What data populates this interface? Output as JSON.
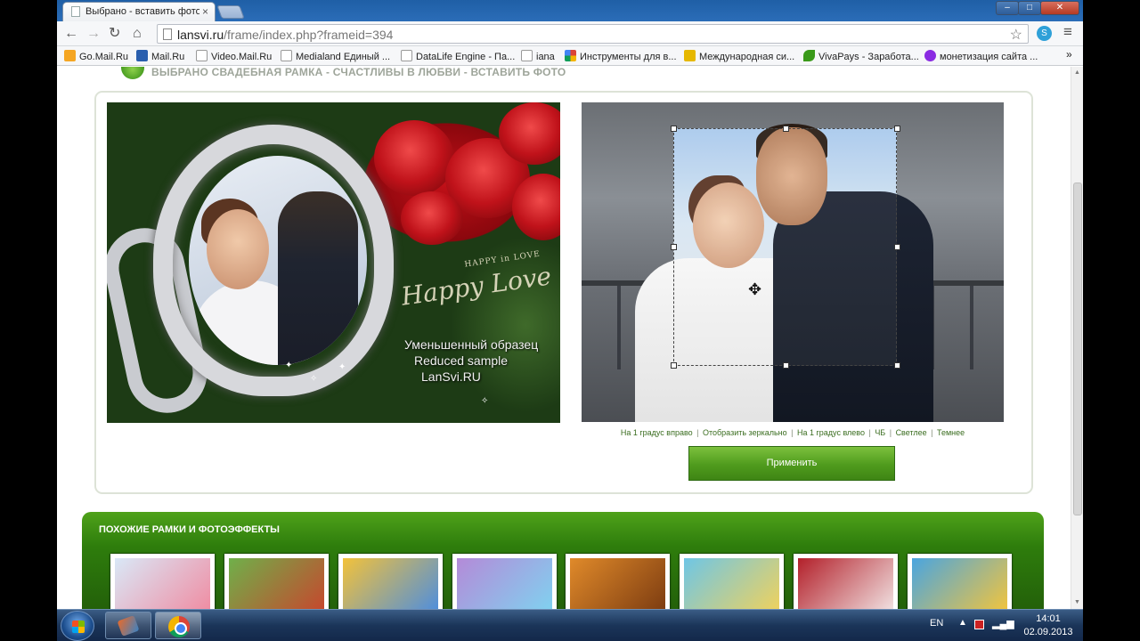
{
  "tab": {
    "title": "Выбрано - вставить фото",
    "close": "×"
  },
  "window": {
    "min": "–",
    "max": "□",
    "close": "✕"
  },
  "toolbar": {
    "back": "←",
    "forward": "→",
    "reload": "↻",
    "home": "⌂",
    "url_host": "lansvi.ru",
    "url_path": "/frame/index.php?frameid=394",
    "star": "☆",
    "menu": "≡"
  },
  "bookmarks": [
    {
      "label": "Go.Mail.Ru",
      "icon": "mail-icon",
      "color": "#f5a623"
    },
    {
      "label": "Mail.Ru",
      "icon": "mail-icon",
      "color": "#2a5fae"
    },
    {
      "label": "Video.Mail.Ru",
      "icon": "page-icon",
      "color": "#ffffff"
    },
    {
      "label": "Medialand Единый ...",
      "icon": "page-icon",
      "color": "#ffffff"
    },
    {
      "label": "DataLife Engine - Па...",
      "icon": "page-icon",
      "color": "#ffffff"
    },
    {
      "label": "iana",
      "icon": "page-icon",
      "color": "#ffffff"
    },
    {
      "label": "Инструменты для в...",
      "icon": "google-icon",
      "color": "#4285f4"
    },
    {
      "label": "Международная си...",
      "icon": "gl-icon",
      "color": "#e6b800"
    },
    {
      "label": "VivaPays - Заработа...",
      "icon": "leaf-icon",
      "color": "#3a9a1a"
    },
    {
      "label": "монетизация сайта ...",
      "icon": "star-icon",
      "color": "#8a2be2"
    }
  ],
  "bookmarks_more": "»",
  "section_title": "ВЫБРАНО СВАДЕБНАЯ РАМКА - СЧАСТЛИВЫ В ЛЮБВИ - ВСТАВИТЬ ФОТО",
  "preview": {
    "watermark": [
      "Уменьшенный образец",
      "Reduced sample",
      "LanSvi.RU"
    ],
    "happy_small": "HAPPY in LOVE",
    "happy_script": "Happy Love"
  },
  "edit_links": [
    "На 1 градус вправо",
    "Отобразить зеркально",
    "На 1 градус влево",
    "ЧБ",
    "Светлее",
    "Темнее"
  ],
  "apply_button": "Применить",
  "similar": {
    "title": "ПОХОЖИЕ РАМКИ И ФОТОЭФФЕКТЫ",
    "thumbs": [
      {
        "color": "#d9e8f7",
        "accent": "#f08aa0"
      },
      {
        "color": "#6fb04a",
        "accent": "#c8452d"
      },
      {
        "color": "#f3c23a",
        "accent": "#4b8de0"
      },
      {
        "color": "#b48ad8",
        "accent": "#7fd3f0"
      },
      {
        "color": "#e08a2a",
        "accent": "#7a3a10"
      },
      {
        "color": "#6ec6e6",
        "accent": "#f2d25a"
      },
      {
        "color": "#b3202a",
        "accent": "#f2e6e6"
      },
      {
        "color": "#4aa5e0",
        "accent": "#f5c53a"
      }
    ]
  },
  "taskbar": {
    "lang": "EN",
    "time": "14:01",
    "date": "02.09.2013"
  }
}
